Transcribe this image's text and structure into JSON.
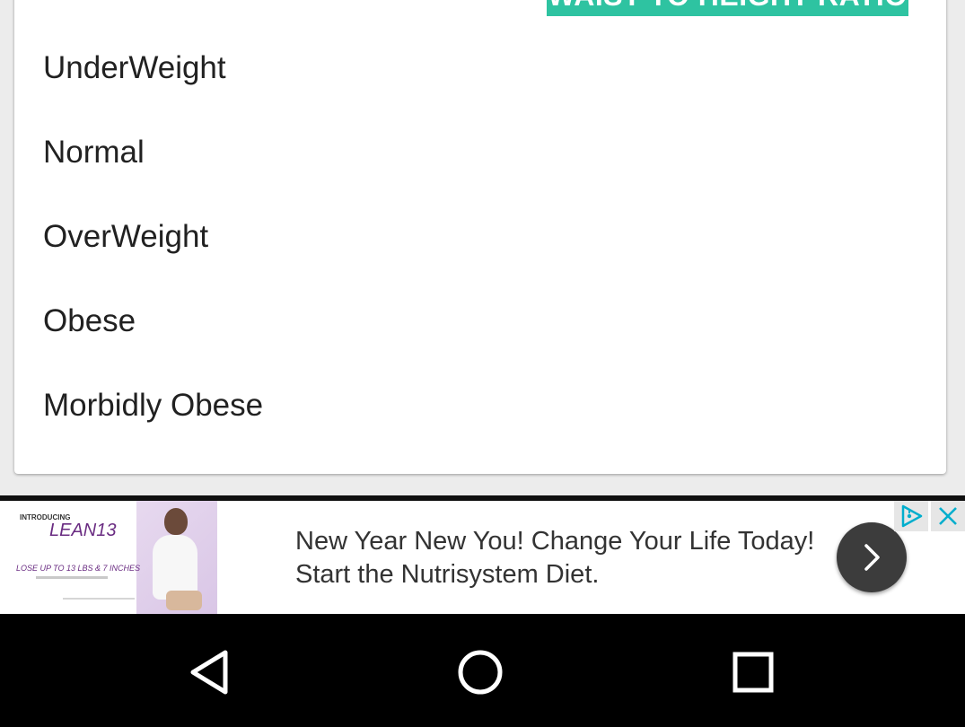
{
  "header": {
    "button_label": "WAIST TO HEIGHT RATIO"
  },
  "list": {
    "items": [
      {
        "label": "UnderWeight"
      },
      {
        "label": "Normal"
      },
      {
        "label": "OverWeight"
      },
      {
        "label": "Obese"
      },
      {
        "label": "Morbidly Obese"
      }
    ]
  },
  "ad": {
    "thumb_intro": "INTRODUCING",
    "thumb_brand": "LEAN13",
    "thumb_tagline": "LOSE UP TO 13 LBS & 7 INCHES",
    "text": "New Year New You! Change Your Life Today! Start the Nutrisystem Diet.",
    "next_icon": "chevron-right-icon",
    "choices_icon": "adchoices-icon",
    "close_icon": "close-icon"
  },
  "navbar": {
    "back_icon": "back-triangle-icon",
    "home_icon": "home-circle-icon",
    "recents_icon": "recents-square-icon"
  },
  "colors": {
    "accent": "#2ec3a1",
    "text": "#212121",
    "ad_text": "#333333",
    "ad_button": "#3c3c3c",
    "adchoices": "#00aecd",
    "navbar": "#000000"
  }
}
